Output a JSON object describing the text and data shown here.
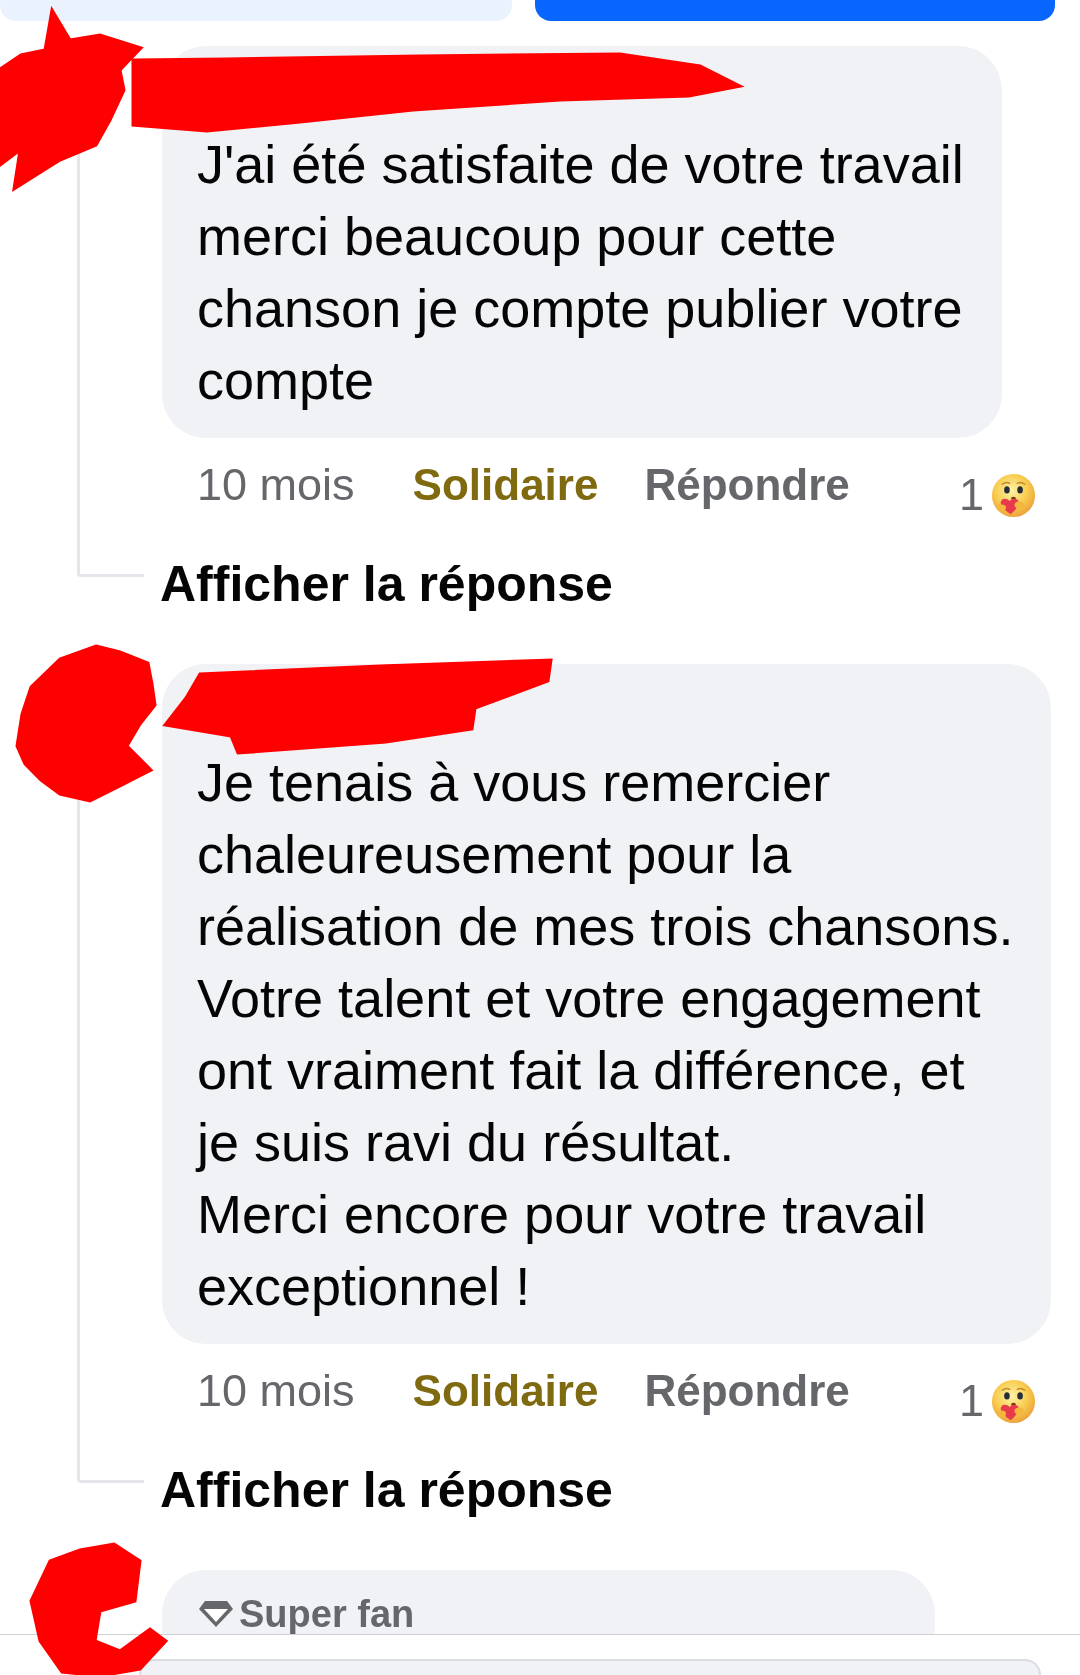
{
  "action_buttons": [
    {
      "kind": "secondary"
    },
    {
      "kind": "primary"
    }
  ],
  "comments": [
    {
      "author_redacted": true,
      "text": "J'ai été satisfaite de votre travail\nmerci beaucoup pour cette\nchanson je compte publier votre\ncompte",
      "time": "10 mois",
      "reaction_label": "Solidaire",
      "reaction_selected": true,
      "reply_label": "Répondre",
      "reaction_count": "1",
      "view_replies": "Afficher la réponse"
    },
    {
      "author_redacted": true,
      "text": "Je tenais à vous remercier\nchaleureusement pour la\nréalisation de mes trois chansons.\nVotre talent et votre engagement\nont vraiment fait la différence, et\nje suis ravi du résultat.\nMerci encore pour votre travail\nexceptionnel !",
      "time": "10 mois",
      "reaction_label": "Solidaire",
      "reaction_selected": true,
      "reply_label": "Répondre",
      "reaction_count": "1",
      "view_replies": "Afficher la réponse"
    },
    {
      "author_redacted": true,
      "badge": "Super fan"
    }
  ]
}
